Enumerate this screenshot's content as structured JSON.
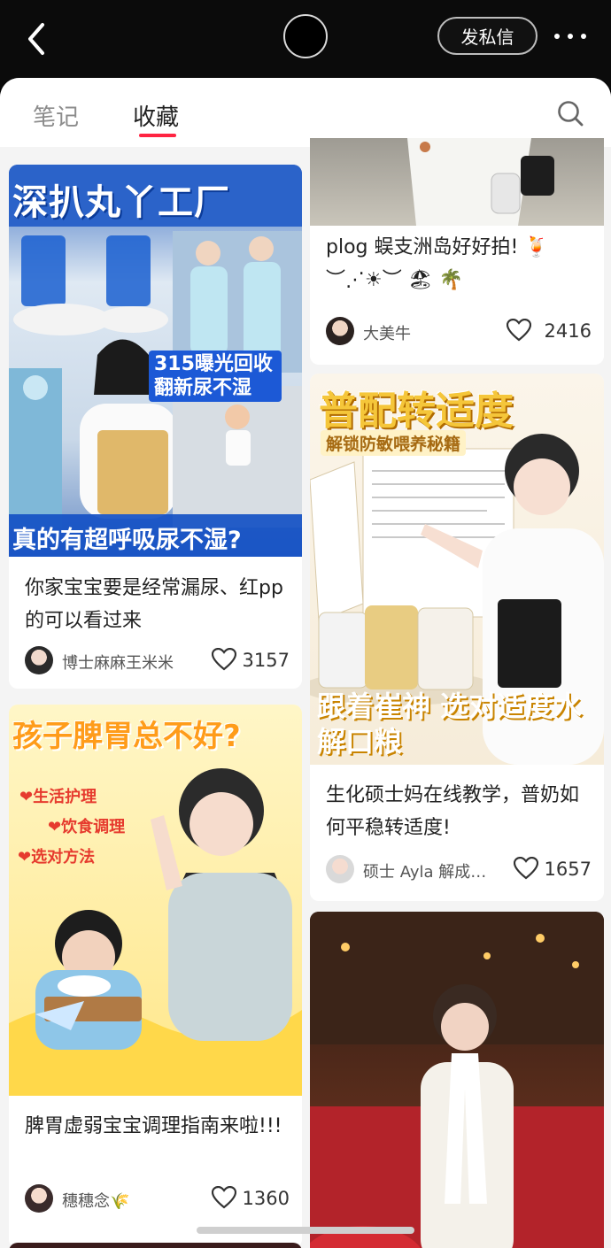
{
  "header": {
    "dm_label": "发私信"
  },
  "tabs": [
    {
      "label": "笔记"
    },
    {
      "label": "收藏"
    }
  ],
  "left_cards": [
    {
      "overlay_top": "深扒丸丫工厂",
      "overlay_mid": "315曝光回收翻新尿不湿",
      "overlay_bottom": "真的有超呼吸尿不湿?",
      "title": "你家宝宝要是经常漏尿、红pp的可以看过来",
      "author": "博士麻麻王米米",
      "likes": "3157"
    },
    {
      "overlay_top": "孩子脾胃总不好?",
      "bullets": [
        "生活护理",
        "饮食调理",
        "选对方法"
      ],
      "title": "脾胃虚弱宝宝调理指南来啦!!!",
      "author": "穗穗念🌾",
      "likes": "1360"
    }
  ],
  "right_cards": [
    {
      "title": "plog 蜈支洲岛好好拍! 🍹\n︶⋰☀︶ 🏖 🌴",
      "author": "大美牛",
      "likes": "2416"
    },
    {
      "overlay_top": "普配转适度",
      "overlay_sub": "解锁防敏喂养秘籍",
      "overlay_bottom": "跟着崔神 选对适度水解口粮",
      "title": "生化硕士妈在线教学，普奶如何平稳转适度!",
      "author": "硕士 Ayla 解成…",
      "likes": "1657"
    }
  ],
  "colors": {
    "accent": "#ff2442",
    "header_bg": "#0b0b0b",
    "panel_bg": "#f4f4f4"
  }
}
